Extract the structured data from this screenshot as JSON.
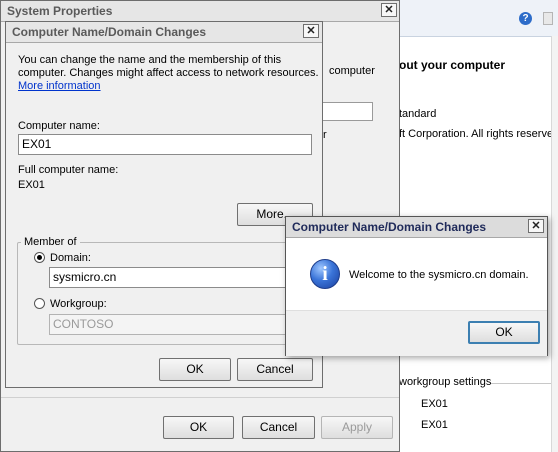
{
  "background_about": {
    "partial_heading": "out your computer",
    "partial_edition": "tandard",
    "partial_copyright": "ft Corporation.  All rights reserve",
    "workgroup_settings": "workgroup settings",
    "value_1": "EX01",
    "value_2": "EX01",
    "help_icon": "question-icon"
  },
  "system_properties": {
    "title": "System Properties",
    "partial_text_1": "computer",
    "partial_text_2": "r",
    "buttons": {
      "ok": "OK",
      "cancel": "Cancel",
      "apply": "Apply"
    }
  },
  "name_changes": {
    "title": "Computer Name/Domain Changes",
    "description_line1": "You can change the name and the membership of this",
    "description_line2": "computer. Changes might affect access to network resources.",
    "more_info_link": "More information",
    "computer_name_label": "Computer name:",
    "computer_name_value": "EX01",
    "full_name_label": "Full computer name:",
    "full_name_value": "EX01",
    "more_button": "More...",
    "member_of": {
      "legend": "Member of",
      "domain_label": "Domain:",
      "domain_value": "sysmicro.cn",
      "domain_selected": true,
      "workgroup_label": "Workgroup:",
      "workgroup_value": "CONTOSO"
    },
    "buttons": {
      "ok": "OK",
      "cancel": "Cancel"
    }
  },
  "welcome_dialog": {
    "title": "Computer Name/Domain Changes",
    "icon": "info-icon",
    "message": "Welcome to the sysmicro.cn domain.",
    "ok": "OK"
  },
  "colors": {
    "dialog_bg": "#f0f0f0",
    "link": "#0033cc",
    "active_title": "#1f2a5a",
    "default_button_border": "#3c7fb1",
    "info_icon": "#3a74d8"
  }
}
